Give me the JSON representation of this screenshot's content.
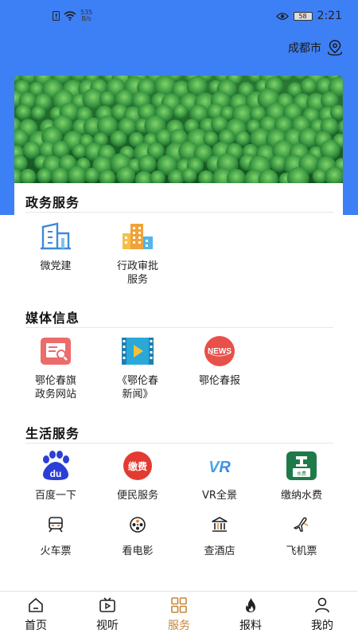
{
  "status_bar": {
    "net_speed_value": "535",
    "net_speed_unit": "B/s",
    "battery": "58",
    "time": "2:21"
  },
  "header": {
    "city": "成都市"
  },
  "sections": {
    "gov": {
      "title": "政务服务",
      "items": [
        {
          "label": "微党建",
          "icon": "building-icon"
        },
        {
          "label": "行政审批\n服务",
          "icon": "city-buildings-icon"
        }
      ]
    },
    "media": {
      "title": "媒体信息",
      "items": [
        {
          "label": "鄂伦春旗\n政务网站",
          "icon": "website-icon"
        },
        {
          "label": "《鄂伦春\n新闻》",
          "icon": "video-icon"
        },
        {
          "label": "鄂伦春报",
          "icon": "news-icon",
          "badge": "NEWS"
        }
      ]
    },
    "life": {
      "title": "生活服务",
      "items": [
        {
          "label": "百度一下",
          "icon": "baidu-icon",
          "badge": "du"
        },
        {
          "label": "便民服务",
          "icon": "payment-icon",
          "badge": "缴费"
        },
        {
          "label": "VR全景",
          "icon": "vr-icon",
          "badge": "VR"
        },
        {
          "label": "缴纳水费",
          "icon": "water-fee-icon",
          "badge": "水费"
        },
        {
          "label": "火车票",
          "icon": "train-icon"
        },
        {
          "label": "看电影",
          "icon": "film-reel-icon"
        },
        {
          "label": "查酒店",
          "icon": "hotel-icon"
        },
        {
          "label": "飞机票",
          "icon": "airplane-icon"
        }
      ]
    }
  },
  "tabs": [
    {
      "label": "首页",
      "icon": "home-icon"
    },
    {
      "label": "视听",
      "icon": "tv-icon"
    },
    {
      "label": "服务",
      "icon": "grid-icon",
      "active": true
    },
    {
      "label": "报料",
      "icon": "fire-icon"
    },
    {
      "label": "我的",
      "icon": "person-icon"
    }
  ],
  "colors": {
    "header_blue": "#3d7ff5",
    "active_tab": "#c8873a"
  }
}
